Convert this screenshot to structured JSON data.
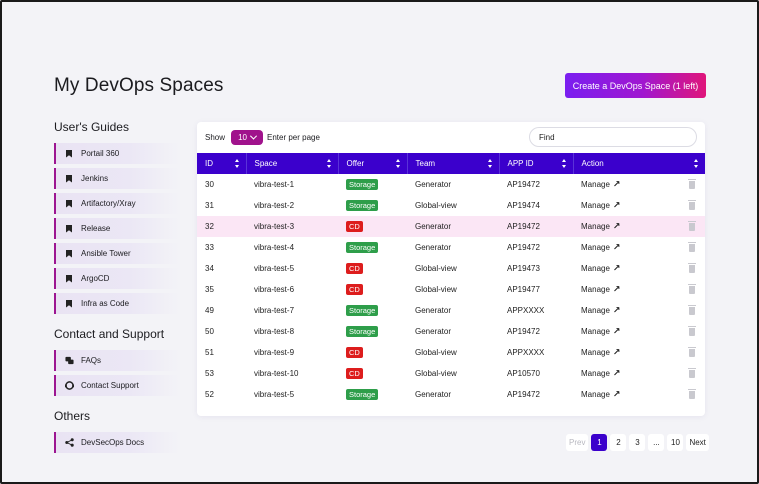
{
  "header": {
    "title": "My DevOps Spaces",
    "create_label": "Create a DevOps Space (1 left)"
  },
  "sidebar": {
    "guides_title": "User's Guides",
    "guides": [
      {
        "label": "Portail 360",
        "icon": "bookmark-icon"
      },
      {
        "label": "Jenkins",
        "icon": "bookmark-icon"
      },
      {
        "label": "Artifactory/Xray",
        "icon": "bookmark-icon"
      },
      {
        "label": "Release",
        "icon": "bookmark-icon"
      },
      {
        "label": "Ansible Tower",
        "icon": "bookmark-icon"
      },
      {
        "label": "ArgoCD",
        "icon": "bookmark-icon"
      },
      {
        "label": "Infra as Code",
        "icon": "bookmark-icon"
      }
    ],
    "contact_title": "Contact and Support",
    "contact": [
      {
        "label": "FAQs",
        "icon": "faq-icon"
      },
      {
        "label": "Contact Support",
        "icon": "support-icon"
      }
    ],
    "others_title": "Others",
    "others": [
      {
        "label": "DevSecOps Docs",
        "icon": "share-icon"
      }
    ]
  },
  "table": {
    "show_label": "Show",
    "per_page_value": "10",
    "per_page_suffix": "Enter per page",
    "search_placeholder": "Find",
    "columns": [
      "ID",
      "Space",
      "Offer",
      "Team",
      "APP ID",
      "Action"
    ],
    "rows": [
      {
        "id": "30",
        "space": "vibra-test-1",
        "offer": "Storage",
        "team": "Generator",
        "app_id": "AP19472",
        "action": "Manage"
      },
      {
        "id": "31",
        "space": "vibra-test-2",
        "offer": "Storage",
        "team": "Global-view",
        "app_id": "AP19474",
        "action": "Manage"
      },
      {
        "id": "32",
        "space": "vibra-test-3",
        "offer": "CD",
        "team": "Generator",
        "app_id": "AP19472",
        "action": "Manage"
      },
      {
        "id": "33",
        "space": "vibra-test-4",
        "offer": "Storage",
        "team": "Generator",
        "app_id": "AP19472",
        "action": "Manage"
      },
      {
        "id": "34",
        "space": "vibra-test-5",
        "offer": "CD",
        "team": "Global-view",
        "app_id": "AP19473",
        "action": "Manage"
      },
      {
        "id": "35",
        "space": "vibra-test-6",
        "offer": "CD",
        "team": "Global-view",
        "app_id": "AP19477",
        "action": "Manage"
      },
      {
        "id": "49",
        "space": "vibra-test-7",
        "offer": "Storage",
        "team": "Generator",
        "app_id": "APPXXXX",
        "action": "Manage"
      },
      {
        "id": "50",
        "space": "vibra-test-8",
        "offer": "Storage",
        "team": "Generator",
        "app_id": "AP19472",
        "action": "Manage"
      },
      {
        "id": "51",
        "space": "vibra-test-9",
        "offer": "CD",
        "team": "Global-view",
        "app_id": "APPXXXX",
        "action": "Manage"
      },
      {
        "id": "53",
        "space": "vibra-test-10",
        "offer": "CD",
        "team": "Global-view",
        "app_id": "AP10570",
        "action": "Manage"
      },
      {
        "id": "52",
        "space": "vibra-test-5",
        "offer": "Storage",
        "team": "Generator",
        "app_id": "AP19472",
        "action": "Manage"
      }
    ],
    "highlighted_row_id": "32"
  },
  "pagination": {
    "prev": "Prev",
    "pages": [
      "1",
      "2",
      "3",
      "...",
      "10"
    ],
    "active": "1",
    "next": "Next"
  },
  "colors": {
    "header_bg": "#3b00cc",
    "accent_magenta": "#a0128c",
    "storage_badge": "#2e9e4a",
    "cd_badge": "#dd1d1d",
    "highlight_row": "#fbe6f5"
  }
}
